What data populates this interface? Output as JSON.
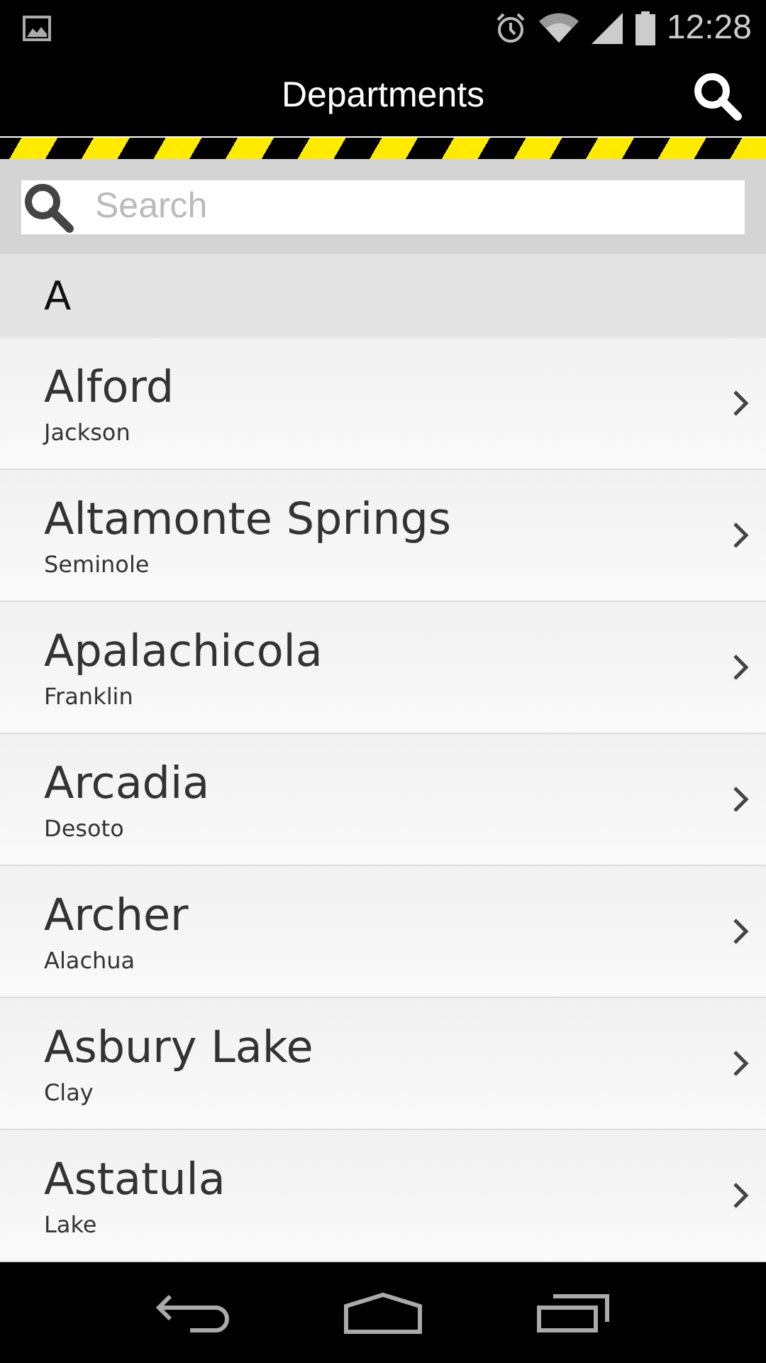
{
  "status_bar": {
    "time": "12:28"
  },
  "header": {
    "title": "Departments"
  },
  "search": {
    "placeholder": "Search"
  },
  "section": {
    "letter": "A"
  },
  "rows": [
    {
      "name": "Alford",
      "county": "Jackson"
    },
    {
      "name": "Altamonte Springs",
      "county": "Seminole"
    },
    {
      "name": "Apalachicola",
      "county": "Franklin"
    },
    {
      "name": "Arcadia",
      "county": "Desoto"
    },
    {
      "name": "Archer",
      "county": "Alachua"
    },
    {
      "name": "Asbury Lake",
      "county": "Clay"
    },
    {
      "name": "Astatula",
      "county": "Lake"
    }
  ]
}
